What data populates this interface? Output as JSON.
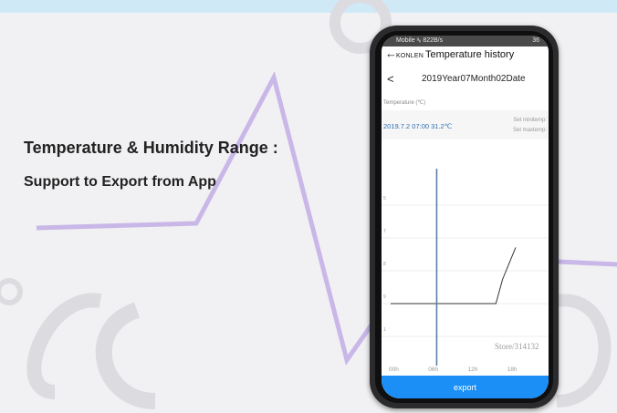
{
  "promo": {
    "headline": "Temperature & Humidity Range :",
    "subheadline": "Support to Export from App"
  },
  "phone": {
    "status_bar": {
      "left": "Mobile ᵃᵢᵢ 822B/s",
      "right": "36"
    },
    "app_bar": {
      "brand": "KONLEN",
      "title": "Temperature history"
    },
    "date_nav": {
      "date": "2019Year07Month02Date"
    },
    "chart_header": {
      "unit_label": "Temperature (℃)",
      "reading": "2019.7.2 07:00 31.2℃",
      "set_min": "Set minitemp:",
      "set_max": "Set maxtemp:"
    },
    "watermark": "Store/314132",
    "export_label": "export"
  },
  "colors": {
    "accent": "#1b8ff5",
    "reading": "#2f6fb6",
    "deco": "#c9b7e8"
  },
  "icons": {
    "back": "arrow-left-icon",
    "prev": "chevron-left-icon"
  },
  "chart_data": {
    "type": "line",
    "x_ticks": [
      "00h",
      "06h",
      "12h",
      "18h"
    ],
    "y_ticks": [
      "5",
      "7",
      "8",
      "9",
      "1"
    ],
    "series": [
      {
        "points": [
          [
            0,
            31.2
          ],
          [
            6,
            31.2
          ],
          [
            12,
            31.2
          ],
          [
            16,
            31.2
          ],
          [
            17,
            31.8
          ],
          [
            19,
            32.6
          ]
        ]
      }
    ],
    "cursor_x": 7
  }
}
